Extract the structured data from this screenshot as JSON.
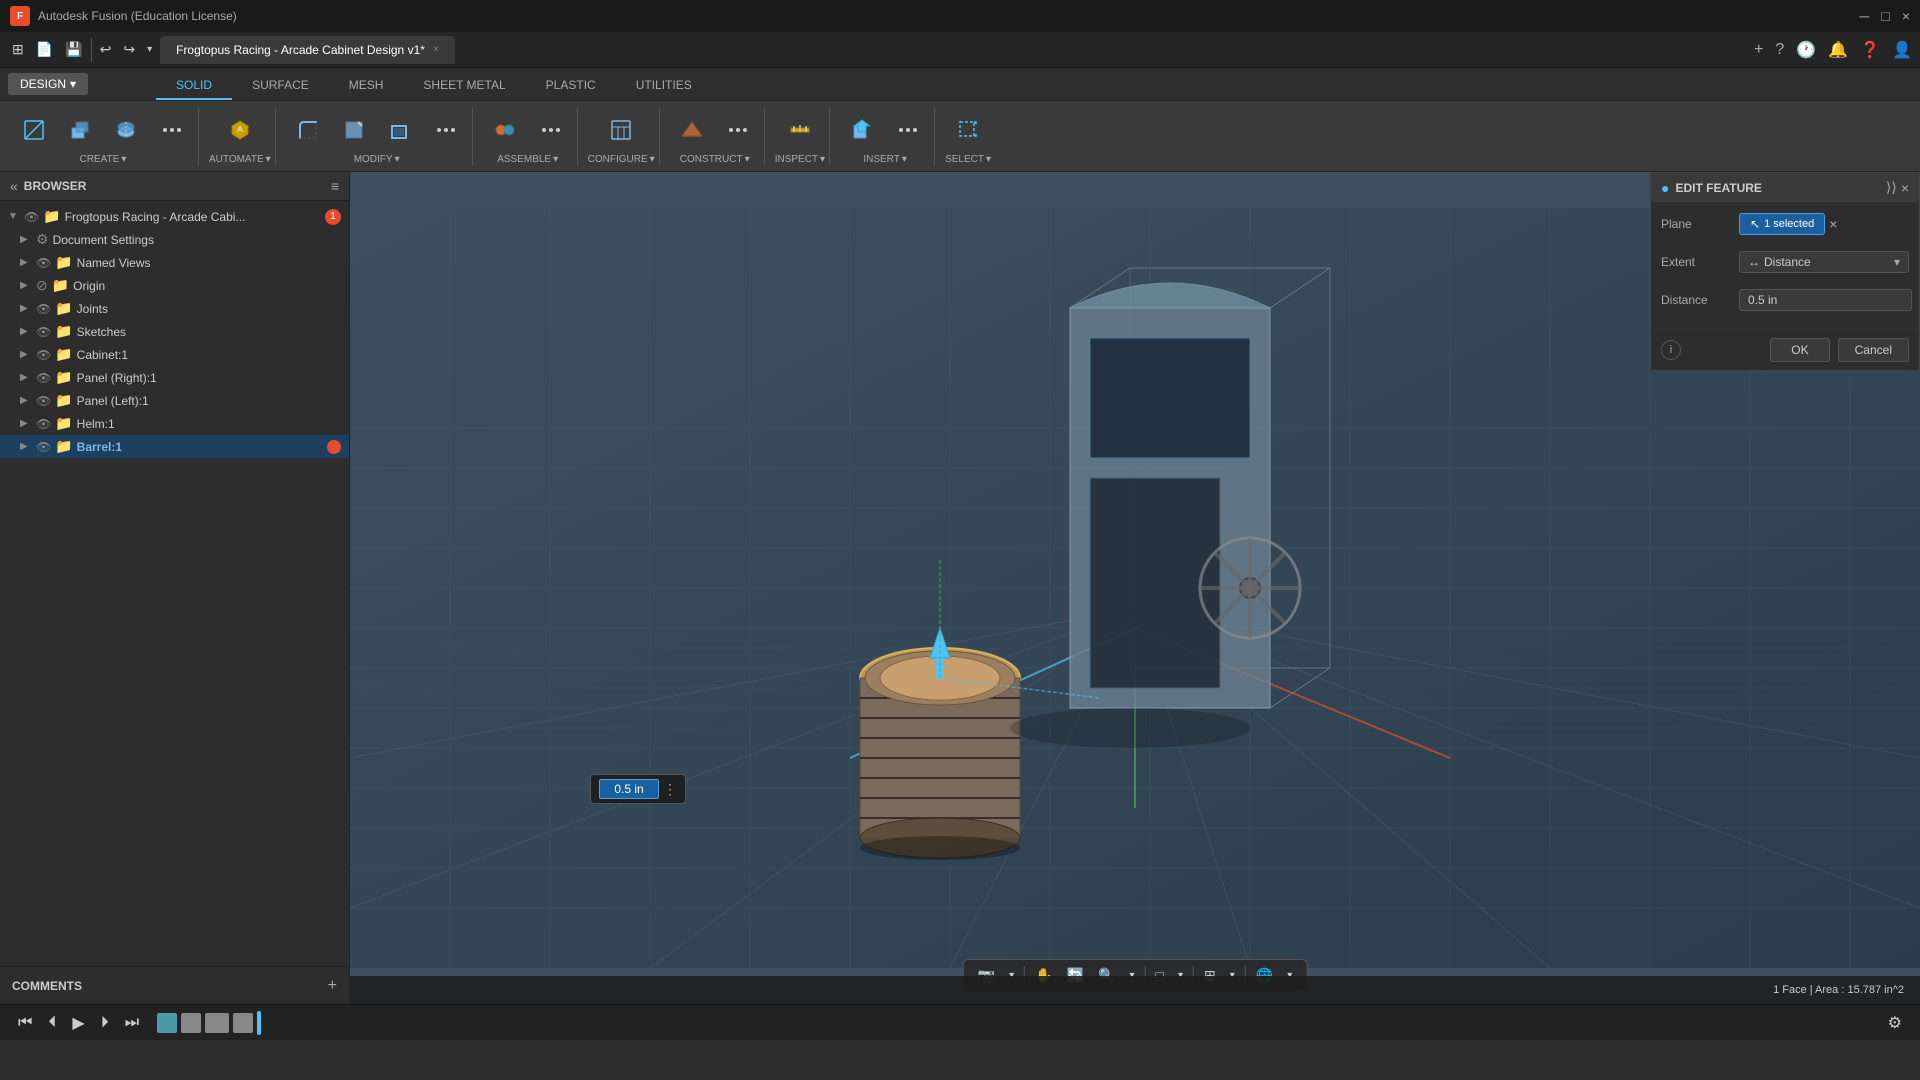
{
  "titlebar": {
    "app_name": "Autodesk Fusion (Education License)",
    "close": "×",
    "minimize": "─",
    "maximize": "□"
  },
  "tabs": [
    {
      "label": "Frogtopus Racing - Arcade Cabinet Design v1*",
      "active": true
    }
  ],
  "tab_controls": {
    "add": "+",
    "help": "?",
    "clock": "🕐",
    "bell": "🔔",
    "question": "?",
    "profile": "👤"
  },
  "toolbar": {
    "design_label": "DESIGN",
    "mode_tabs": [
      {
        "label": "SOLID",
        "active": true
      },
      {
        "label": "SURFACE",
        "active": false
      },
      {
        "label": "MESH",
        "active": false
      },
      {
        "label": "SHEET METAL",
        "active": false
      },
      {
        "label": "PLASTIC",
        "active": false
      },
      {
        "label": "UTILITIES",
        "active": false
      }
    ],
    "groups": [
      {
        "label": "CREATE",
        "has_arrow": true
      },
      {
        "label": "AUTOMATE",
        "has_arrow": true
      },
      {
        "label": "MODIFY",
        "has_arrow": true
      },
      {
        "label": "ASSEMBLE",
        "has_arrow": true
      },
      {
        "label": "CONFIGURE",
        "has_arrow": true
      },
      {
        "label": "CONSTRUCT",
        "has_arrow": true
      },
      {
        "label": "INSPECT",
        "has_arrow": true
      },
      {
        "label": "INSERT",
        "has_arrow": true
      },
      {
        "label": "SELECT",
        "has_arrow": true
      }
    ]
  },
  "browser": {
    "title": "BROWSER",
    "root_item": "Frogtopus Racing - Arcade Cabi...",
    "error_count": "1",
    "items": [
      {
        "label": "Document Settings",
        "indent": 1,
        "type": "settings"
      },
      {
        "label": "Named Views",
        "indent": 1,
        "type": "folder"
      },
      {
        "label": "Origin",
        "indent": 1,
        "type": "folder"
      },
      {
        "label": "Joints",
        "indent": 1,
        "type": "folder"
      },
      {
        "label": "Sketches",
        "indent": 1,
        "type": "folder"
      },
      {
        "label": "Cabinet:1",
        "indent": 1,
        "type": "body"
      },
      {
        "label": "Panel (Right):1",
        "indent": 1,
        "type": "body"
      },
      {
        "label": "Panel (Left):1",
        "indent": 1,
        "type": "body"
      },
      {
        "label": "Helm:1",
        "indent": 1,
        "type": "body"
      },
      {
        "label": "Barrel:1",
        "indent": 1,
        "type": "body",
        "active": true,
        "has_record": true
      }
    ]
  },
  "edit_feature": {
    "title": "EDIT FEATURE",
    "plane_label": "Plane",
    "plane_value": "1 selected",
    "extent_label": "Extent",
    "extent_value": "Distance",
    "distance_label": "Distance",
    "distance_value": "0.5 in",
    "ok_label": "OK",
    "cancel_label": "Cancel"
  },
  "distance_overlay": {
    "value": "0.5 in"
  },
  "viewport": {
    "status": "1 Face | Area : 15.787 in^2"
  },
  "comments": {
    "label": "COMMENTS"
  },
  "animation": {
    "rewind": "⏮",
    "prev": "⏴",
    "play": "▶",
    "next": "⏵",
    "forward": "⏭"
  }
}
